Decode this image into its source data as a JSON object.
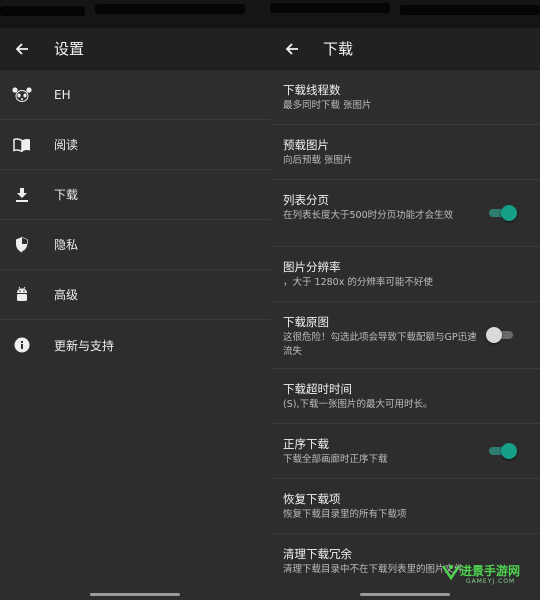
{
  "left": {
    "title": "设置",
    "items": [
      {
        "label": "EH",
        "icon": "panda-icon"
      },
      {
        "label": "阅读",
        "icon": "book-icon"
      },
      {
        "label": "下载",
        "icon": "download-icon"
      },
      {
        "label": "隐私",
        "icon": "shield-icon"
      },
      {
        "label": "高级",
        "icon": "android-icon"
      },
      {
        "label": "更新与支持",
        "icon": "info-icon"
      }
    ]
  },
  "right": {
    "title": "下载",
    "prefs": [
      {
        "title": "下载线程数",
        "summary": "最多同时下载 张图片"
      },
      {
        "title": "预载图片",
        "summary": "向后预载 张图片"
      },
      {
        "title": "列表分页",
        "summary": "在列表长度大于500时分页功能才会生效",
        "switch": true
      },
      {
        "title": "图片分辨率",
        "summary": "，大于 1280x 的分辨率可能不好使"
      },
      {
        "title": "下载原图",
        "summary": "这很危险！勾选此项会导致下载配额与GP迅速流失",
        "switch": false
      },
      {
        "title": "下载超时时间",
        "summary": "(S),下载一张图片的最大可用时长。"
      },
      {
        "title": "正序下载",
        "summary": "下载全部画廊时正序下载",
        "switch": true
      },
      {
        "title": "恢复下载项",
        "summary": "恢复下载目录里的所有下载项"
      },
      {
        "title": "清理下载冗余",
        "summary": "清理下载目录中不在下载列表里的图片文件"
      }
    ]
  },
  "watermark": {
    "main": "进景手游网",
    "sub": "GAMEYJ.COM"
  },
  "colors": {
    "accent": "#16a08a",
    "background": "#2d2d2d",
    "toolbar": "#212121"
  }
}
